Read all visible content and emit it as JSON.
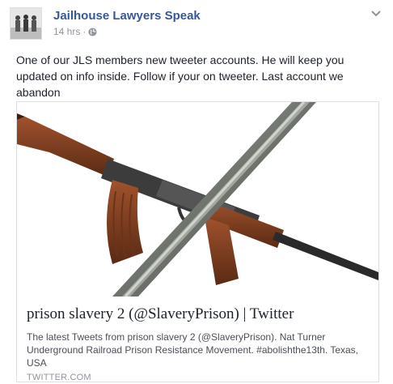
{
  "post": {
    "page_name": "Jailhouse Lawyers Speak",
    "timestamp": "14 hrs",
    "separator": "·",
    "audience_icon": "globe-icon",
    "body": "One of our JLS members new tweeter accounts. He will keep you updated on info inside. Follow if your on tweeter. Last account we abandon"
  },
  "link_preview": {
    "image_icon": "rifle-and-sword-image",
    "title": "prison slavery 2 (@SlaveryPrison) | Twitter",
    "description": "The latest Tweets from prison slavery 2 (@SlaveryPrison). Nat Turner Underground Railroad Prison Resistance Movement. #abolishthe13th. Texas, USA",
    "domain": "TWITTER.COM"
  },
  "colors": {
    "link_blue": "#365899",
    "meta_gray": "#90949c",
    "text": "#1d2129",
    "border": "#dddfe2"
  }
}
